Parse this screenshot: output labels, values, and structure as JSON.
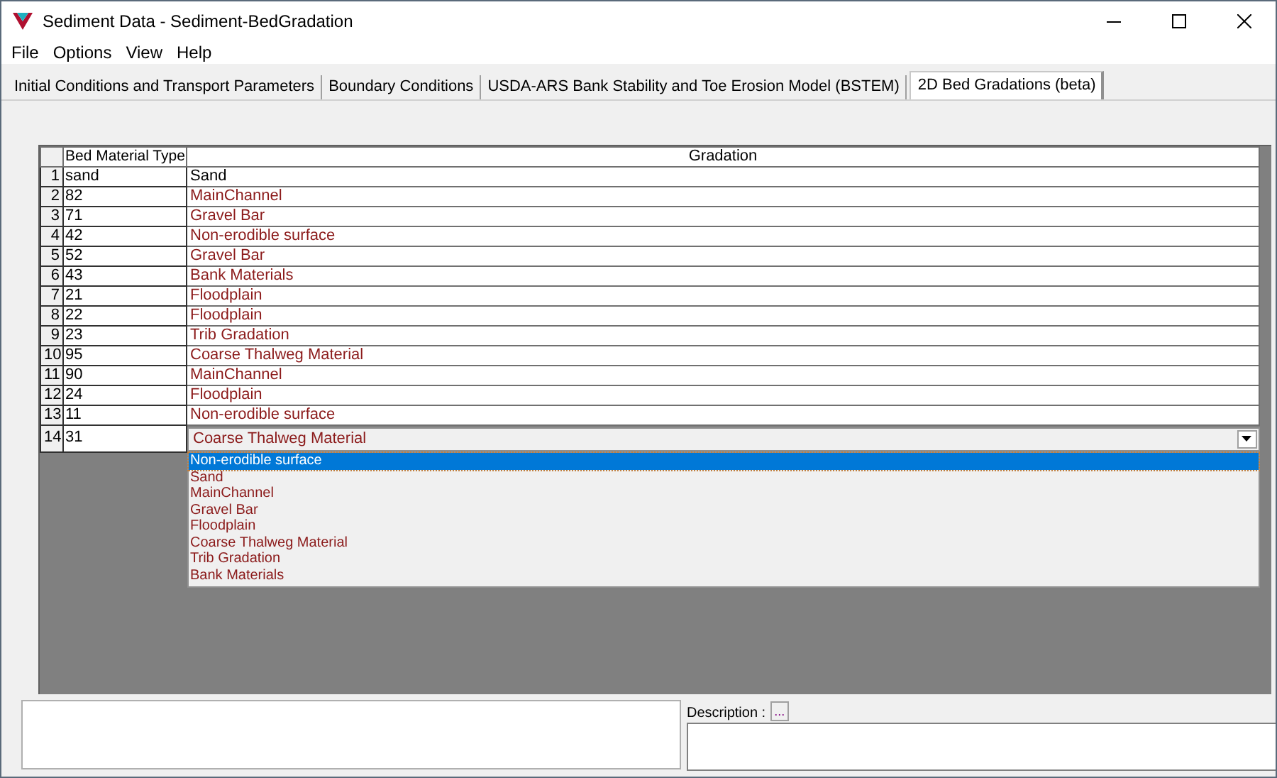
{
  "window": {
    "title": "Sediment Data - Sediment-BedGradation"
  },
  "menu": [
    "File",
    "Options",
    "View",
    "Help"
  ],
  "tabs": [
    {
      "label": "Initial Conditions and Transport Parameters",
      "selected": false
    },
    {
      "label": "Boundary Conditions",
      "selected": false
    },
    {
      "label": "USDA-ARS Bank Stability and Toe Erosion Model (BSTEM)",
      "selected": false
    },
    {
      "label": "2D Bed Gradations (beta)",
      "selected": true
    }
  ],
  "table": {
    "columns": [
      "Bed Material Type",
      "Gradation"
    ],
    "rows": [
      {
        "number": "1",
        "type": "sand",
        "gradation": "Sand",
        "color": "#000000",
        "editing": false
      },
      {
        "number": "2",
        "type": "82",
        "gradation": "MainChannel",
        "color": "#8b1a1a",
        "editing": false
      },
      {
        "number": "3",
        "type": "71",
        "gradation": "Gravel Bar",
        "color": "#8b1a1a",
        "editing": false
      },
      {
        "number": "4",
        "type": "42",
        "gradation": "Non-erodible surface",
        "color": "#8b1a1a",
        "editing": false
      },
      {
        "number": "5",
        "type": "52",
        "gradation": "Gravel Bar",
        "color": "#8b1a1a",
        "editing": false
      },
      {
        "number": "6",
        "type": "43",
        "gradation": "Bank Materials",
        "color": "#8b1a1a",
        "editing": false
      },
      {
        "number": "7",
        "type": "21",
        "gradation": "Floodplain",
        "color": "#8b1a1a",
        "editing": false
      },
      {
        "number": "8",
        "type": "22",
        "gradation": "Floodplain",
        "color": "#8b1a1a",
        "editing": false
      },
      {
        "number": "9",
        "type": "23",
        "gradation": "Trib Gradation",
        "color": "#8b1a1a",
        "editing": false
      },
      {
        "number": "10",
        "type": "95",
        "gradation": "Coarse Thalweg Material",
        "color": "#8b1a1a",
        "editing": false
      },
      {
        "number": "11",
        "type": "90",
        "gradation": "MainChannel",
        "color": "#8b1a1a",
        "editing": false
      },
      {
        "number": "12",
        "type": "24",
        "gradation": "Floodplain",
        "color": "#8b1a1a",
        "editing": false
      },
      {
        "number": "13",
        "type": "11",
        "gradation": "Non-erodible surface",
        "color": "#8b1a1a",
        "editing": false
      },
      {
        "number": "14",
        "type": "31",
        "gradation": "Coarse Thalweg Material",
        "color": "#8b1a1a",
        "editing": true
      }
    ]
  },
  "dropdown": {
    "options": [
      {
        "label": "Non-erodible surface",
        "selected": true
      },
      {
        "label": "Sand",
        "selected": false
      },
      {
        "label": "MainChannel",
        "selected": false
      },
      {
        "label": "Gravel Bar",
        "selected": false
      },
      {
        "label": "Floodplain",
        "selected": false
      },
      {
        "label": "Coarse Thalweg Material",
        "selected": false
      },
      {
        "label": "Trib Gradation",
        "selected": false
      },
      {
        "label": "Bank Materials",
        "selected": false
      }
    ]
  },
  "description": {
    "label": "Description :",
    "button": "..."
  }
}
